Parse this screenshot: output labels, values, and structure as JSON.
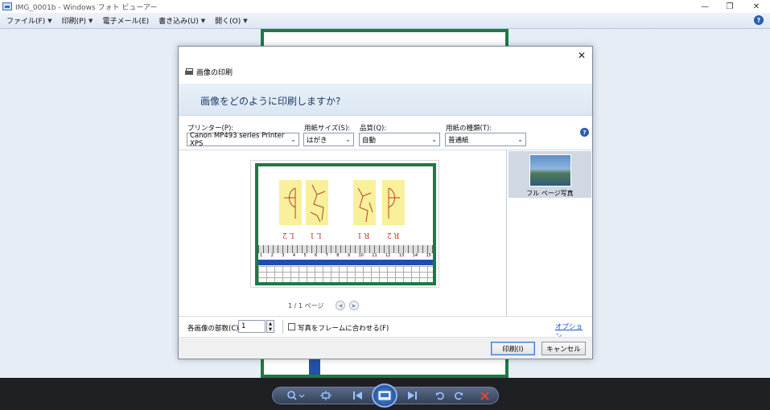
{
  "window": {
    "title": "IMG_0001b - Windows フォト ビューアー",
    "minimize": "—",
    "restore": "❐",
    "close": "✕"
  },
  "menubar": {
    "items": [
      {
        "label": "ファイル(F)"
      },
      {
        "label": "印刷(P)"
      },
      {
        "label": "電子メール(E)"
      },
      {
        "label": "書き込み(U)"
      },
      {
        "label": "開く(O)"
      }
    ],
    "help": "?"
  },
  "dialog": {
    "title": "画像の印刷",
    "close": "✕",
    "question": "画像をどのように印刷しますか?",
    "printer": {
      "label": "プリンター(P):",
      "value": "Canon MP493 series Printer XPS"
    },
    "paper_size": {
      "label": "用紙サイズ(S):",
      "value": "はがき"
    },
    "quality": {
      "label": "品質(Q):",
      "value": "自動"
    },
    "paper_type": {
      "label": "用紙の種類(T):",
      "value": "普通紙"
    },
    "help": "?",
    "preview": {
      "card_labels": [
        "L 2",
        "L 1",
        "R 1",
        "R 2"
      ],
      "ruler_numbers": [
        "1",
        "2",
        "3",
        "4",
        "5",
        "6",
        "7",
        "8",
        "9",
        "10",
        "11",
        "12",
        "13",
        "14",
        "15"
      ]
    },
    "page_count": "1 / 1 ページ",
    "layout_option": {
      "label": "フル ページ写真"
    },
    "copies": {
      "label": "各画像の部数(C):",
      "value": "1"
    },
    "fit_frame": {
      "label": "写真をフレームに合わせる(F)",
      "checked": false
    },
    "options_link": "オプション...",
    "print_button": "印刷(I)",
    "cancel_button": "キャンセル"
  },
  "toolbar": {
    "controls": [
      "zoom",
      "actual-size",
      "previous",
      "slideshow",
      "next",
      "rotate-ccw",
      "rotate-cw",
      "delete"
    ]
  },
  "colors": {
    "accent": "#2a5db0",
    "photo_border": "#1c7a46",
    "taskbar": "#1e2024",
    "delete": "#e0443a"
  }
}
